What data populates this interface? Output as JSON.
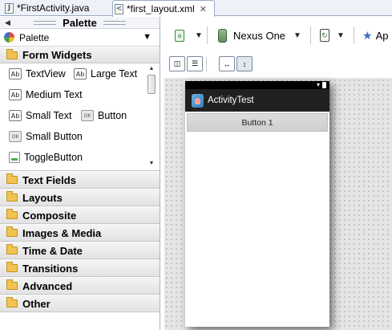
{
  "tabs": [
    {
      "label": "*FirstActivity.java",
      "icon": "java-file-icon",
      "active": false
    },
    {
      "label": "*first_layout.xml",
      "icon": "xml-file-icon",
      "active": true,
      "close": "✕"
    }
  ],
  "palette": {
    "title": "Palette",
    "selector_label": "Palette",
    "form_widgets": {
      "label": "Form Widgets",
      "items": [
        {
          "label": "TextView",
          "icon": "Ab"
        },
        {
          "label": "Large Text",
          "icon": "Ab"
        },
        {
          "label": "Medium Text",
          "icon": "Ab"
        },
        {
          "label": "Small Text",
          "icon": "Ab"
        },
        {
          "label": "Button",
          "icon": "OK"
        },
        {
          "label": "Small Button",
          "icon": "OK"
        },
        {
          "label": "ToggleButton",
          "icon": ""
        }
      ]
    },
    "categories": [
      "Text Fields",
      "Layouts",
      "Composite",
      "Images & Media",
      "Time & Date",
      "Transitions",
      "Advanced",
      "Other"
    ]
  },
  "toolbar": {
    "device_label": "Nexus One",
    "theme_label": "Ap"
  },
  "preview": {
    "app_title": "ActivityTest",
    "button_label": "Button 1"
  },
  "colors": {
    "tab_bar_bg": "#eef2f8",
    "action_bar_bg": "#202020",
    "canvas_bg": "#e5e5e5",
    "folder": "#f0c350"
  }
}
